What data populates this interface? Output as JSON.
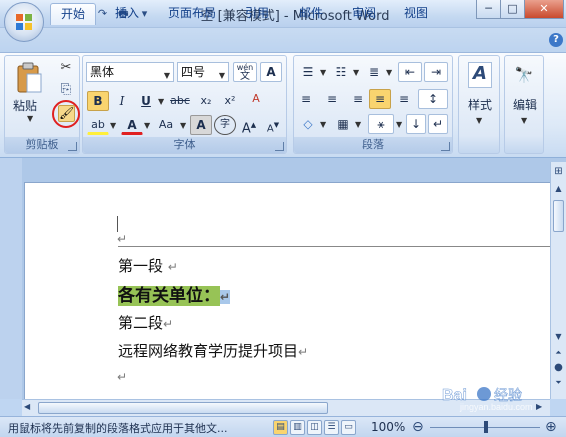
{
  "window": {
    "title": "空 [兼容模式] - Microsoft Word",
    "min": "─",
    "max": "□",
    "close": "✕"
  },
  "qat": {
    "save": "💾",
    "undo": "↶",
    "redo": "↷",
    "print": "🖶",
    "more": "▾"
  },
  "tabs": [
    "开始",
    "插入",
    "页面布局",
    "引用",
    "邮件",
    "审阅",
    "视图"
  ],
  "help": "?",
  "clipboard": {
    "paste_label": "粘贴",
    "cut": "✂",
    "copy": "⎘",
    "format_painter": "🖌",
    "group_label": "剪贴板"
  },
  "font": {
    "name": "黑体",
    "size": "四号",
    "phonetic": "wén",
    "border": "A",
    "bold": "B",
    "italic": "I",
    "underline": "U",
    "strike": "abc",
    "sub": "x₂",
    "sup": "x²",
    "clear": "A",
    "highlight": "ab",
    "color": "A",
    "case": "Aa",
    "shade": "A",
    "enclose": "字",
    "grow": "A",
    "shrink": "A",
    "group_label": "字体"
  },
  "paragraph": {
    "bullets": "☰",
    "numbering": "☷",
    "multilevel": "≣",
    "dec_indent": "⇤",
    "inc_indent": "⇥",
    "align_left": "≡",
    "center": "≡",
    "align_right": "≡",
    "justify": "≡",
    "distribute": "≡",
    "spacing": "↕",
    "shading": "◇",
    "border": "▦",
    "sort": "⚹",
    "marks": "↵",
    "group_label": "段落"
  },
  "styles": {
    "label": "样式",
    "icon": "A"
  },
  "editing": {
    "label": "编辑",
    "icon": "🔭"
  },
  "document": {
    "paragraphs": [
      "第一段",
      "各有关单位：",
      "第二段",
      "远程网络教育学历提升项目"
    ],
    "mark": "↵"
  },
  "status": {
    "text": "用鼠标将先前复制的段落格式应用于其他文...",
    "zoom": "100%",
    "zoom_out": "⊖",
    "zoom_in": "⊕",
    "watermark": "jingyan.baidu.com"
  },
  "colors": {
    "accent": "#15428b",
    "highlight": "#97c356",
    "selection": "#a9c8ea",
    "circle": "#e02020"
  }
}
